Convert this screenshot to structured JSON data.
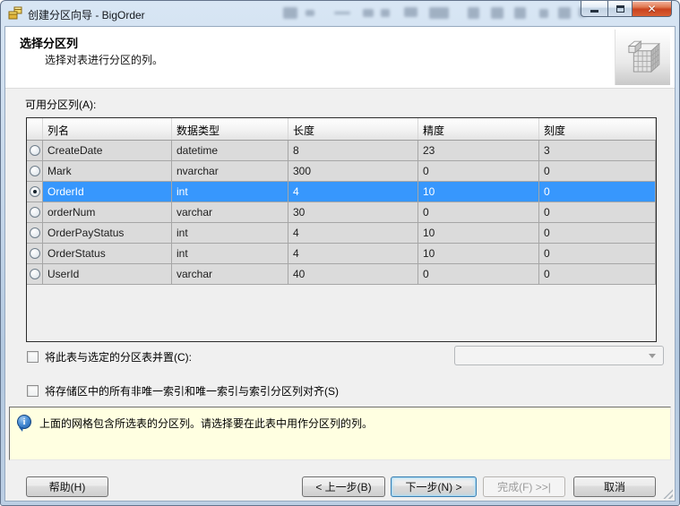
{
  "window": {
    "title": "创建分区向导 - BigOrder"
  },
  "header": {
    "title": "选择分区列",
    "subtitle": "选择对表进行分区的列。"
  },
  "main": {
    "available_label": "可用分区列(A):",
    "table": {
      "columns": [
        "列名",
        "数据类型",
        "长度",
        "精度",
        "刻度"
      ],
      "rows": [
        {
          "name": "CreateDate",
          "type": "datetime",
          "length": "8",
          "precision": "23",
          "scale": "3",
          "selected": false
        },
        {
          "name": "Mark",
          "type": "nvarchar",
          "length": "300",
          "precision": "0",
          "scale": "0",
          "selected": false
        },
        {
          "name": "OrderId",
          "type": "int",
          "length": "4",
          "precision": "10",
          "scale": "0",
          "selected": true
        },
        {
          "name": "orderNum",
          "type": "varchar",
          "length": "30",
          "precision": "0",
          "scale": "0",
          "selected": false
        },
        {
          "name": "OrderPayStatus",
          "type": "int",
          "length": "4",
          "precision": "10",
          "scale": "0",
          "selected": false
        },
        {
          "name": "OrderStatus",
          "type": "int",
          "length": "4",
          "precision": "10",
          "scale": "0",
          "selected": false
        },
        {
          "name": "UserId",
          "type": "varchar",
          "length": "40",
          "precision": "0",
          "scale": "0",
          "selected": false
        }
      ]
    },
    "collocate_checkbox_label": "将此表与选定的分区表并置(C):",
    "collocate_combo_value": "",
    "align_checkbox_label": "将存储区中的所有非唯一索引和唯一索引与索引分区列对齐(S)"
  },
  "info": {
    "message": "上面的网格包含所选表的分区列。请选择要在此表中用作分区列的列。"
  },
  "footer": {
    "help": "帮助(H)",
    "back": "< 上一步(B)",
    "next": "下一步(N) >",
    "finish": "完成(F) >>|",
    "cancel": "取消"
  },
  "icons": {
    "minimize": "minimize-dash",
    "maximize": "maximize-square",
    "close": "✕",
    "dropdown": "▼",
    "info": "i"
  },
  "colors": {
    "selection_blue": "#3797fd",
    "info_bg": "#ffffe1",
    "titlebar_blue": "#c3d5e9",
    "close_red": "#d0502e",
    "grid_row_bg": "#dbdbdb"
  }
}
